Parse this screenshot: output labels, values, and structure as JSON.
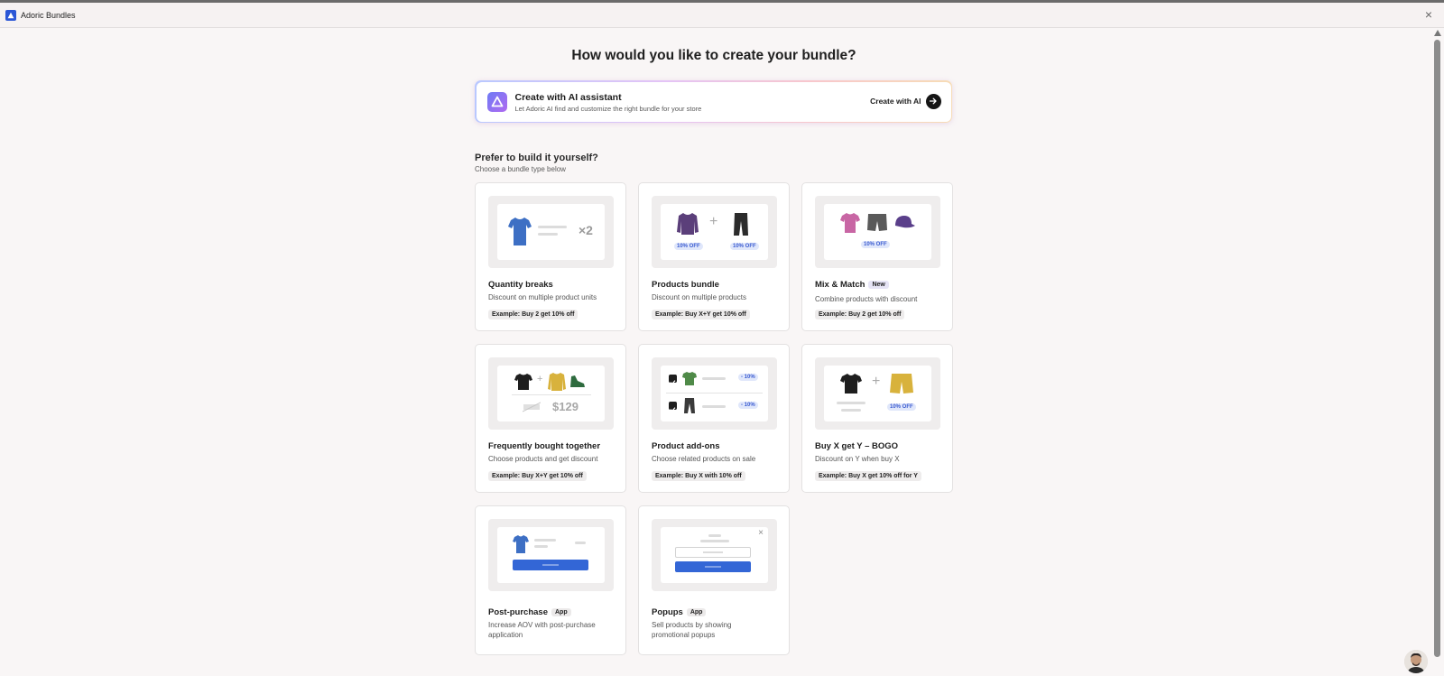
{
  "window": {
    "title": "Adoric Bundles"
  },
  "heading": "How would you like to create your bundle?",
  "ai_card": {
    "title": "Create with AI assistant",
    "subtitle": "Let Adoric AI find and customize the right bundle for your store",
    "cta": "Create with AI"
  },
  "section": {
    "title": "Prefer to build it yourself?",
    "subtitle": "Choose a bundle type below"
  },
  "cards": {
    "quantity": {
      "title": "Quantity breaks",
      "desc": "Discount on multiple product units",
      "example": "Example: Buy 2 get 10% off",
      "multiplier": "×2"
    },
    "bundle": {
      "title": "Products bundle",
      "desc": "Discount on multiple products",
      "example": "Example: Buy X+Y get 10% off",
      "off1": "10% OFF",
      "off2": "10% OFF"
    },
    "mixmatch": {
      "title": "Mix & Match",
      "tag": "New",
      "desc": "Combine products with discount",
      "example": "Example: Buy 2 get 10% off",
      "off": "10% OFF"
    },
    "fbt": {
      "title": "Frequently bought together",
      "desc": "Choose products and get discount",
      "example": "Example: Buy X+Y get 10% off",
      "price": "$129"
    },
    "addons": {
      "title": "Product add-ons",
      "desc": "Choose related products on sale",
      "example": "Example: Buy X with 10% off",
      "off1": "- 10%",
      "off2": "- 10%"
    },
    "bogo": {
      "title": "Buy X get Y – BOGO",
      "desc": "Discount on Y when buy X",
      "example": "Example: Buy X get 10% off for Y",
      "off": "10% OFF"
    },
    "postpurchase": {
      "title": "Post-purchase",
      "tag": "App",
      "desc": "Increase AOV with post-purchase application"
    },
    "popups": {
      "title": "Popups",
      "tag": "App",
      "desc": "Sell products by showing promotional popups"
    }
  },
  "colors": {
    "accent": "#3366d6",
    "brand": "#2b56d6",
    "ai_gradient": [
      "#b9c8ff",
      "#e4c4f6",
      "#f8c7cd",
      "#f7dcb6"
    ]
  },
  "icons": [
    "adoric-logo-icon",
    "close-icon",
    "ai-logo-icon",
    "arrow-right-icon",
    "tshirt-icon",
    "sweater-icon",
    "pants-icon",
    "shorts-icon",
    "cap-icon",
    "sneaker-icon",
    "checkbox-icon"
  ]
}
